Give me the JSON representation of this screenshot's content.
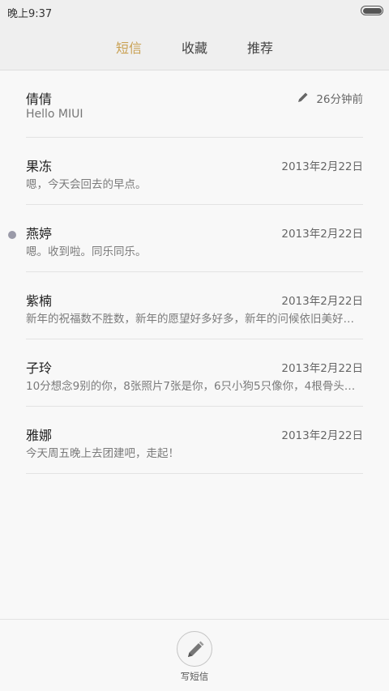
{
  "status_bar": {
    "time": "晚上9:37",
    "battery_level": 1.0
  },
  "tabs": [
    {
      "label": "短信",
      "active": true
    },
    {
      "label": "收藏",
      "active": false
    },
    {
      "label": "推荐",
      "active": false
    }
  ],
  "messages": [
    {
      "name": "倩倩",
      "time": "26分钟前",
      "preview": "Hello MIUI",
      "draft": true,
      "unread": false
    },
    {
      "name": "果冻",
      "time": "2013年2月22日",
      "preview": "嗯，今天会回去的早点。",
      "draft": false,
      "unread": false
    },
    {
      "name": "燕婷",
      "time": "2013年2月22日",
      "preview": "嗯。收到啦。同乐同乐。",
      "draft": false,
      "unread": true
    },
    {
      "name": "紫楠",
      "time": "2013年2月22日",
      "preview": "新年的祝福数不胜数，新年的愿望好多好多，新年的问候依旧美好…",
      "draft": false,
      "unread": false
    },
    {
      "name": "子玲",
      "time": "2013年2月22日",
      "preview": "10分想念9别的你，8张照片7张是你，6只小狗5只像你，4根骨头…",
      "draft": false,
      "unread": false
    },
    {
      "name": "雅娜",
      "time": "2013年2月22日",
      "preview": "今天周五晚上去团建吧，走起！",
      "draft": false,
      "unread": false
    }
  ],
  "bottom_bar": {
    "compose_label": "写短信",
    "compose_icon": "pencil-icon"
  },
  "colors": {
    "accent": "#c9a153",
    "unread_dot": "#9a9aa8"
  }
}
